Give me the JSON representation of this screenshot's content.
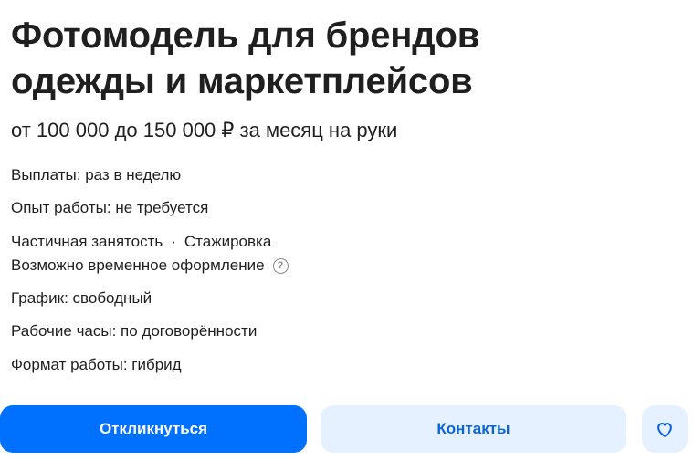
{
  "vacancy": {
    "title_line1": "Фотомодель для брендов",
    "title_line2": "одежды и маркетплейсов",
    "salary": "от 100 000 до 150 000 ₽ за месяц на руки",
    "payments": "Выплаты: раз в неделю",
    "experience": "Опыт работы: не требуется",
    "employment": "Частичная занятость",
    "employment_separator": "·",
    "employment_extra": "Стажировка",
    "registration": "Возможно временное оформление",
    "help_glyph": "?",
    "schedule": "График: свободный",
    "hours": "Рабочие часы: по договорённости",
    "format": "Формат работы: гибрид"
  },
  "actions": {
    "respond_label": "Откликнуться",
    "contacts_label": "Контакты",
    "favorite_icon": "heart-icon"
  },
  "colors": {
    "primary": "#0070ff",
    "secondary_bg": "#e6f1ff",
    "secondary_text": "#0a64d8",
    "text": "#1f1f1f",
    "muted": "#8c8c8c"
  }
}
